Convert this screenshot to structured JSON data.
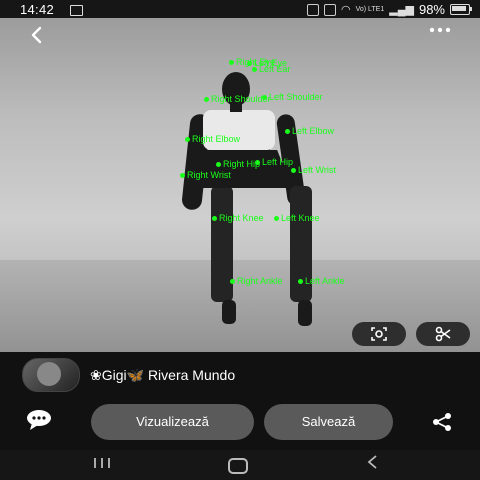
{
  "status": {
    "time": "14:42",
    "battery": "98%",
    "network_label": "Vo) LTE1"
  },
  "photo": {
    "keypoints": [
      {
        "label": "Right Eye"
      },
      {
        "label": "Left Eye"
      },
      {
        "label": "Left Ear"
      },
      {
        "label": "Right Shoulder"
      },
      {
        "label": "Left Shoulder"
      },
      {
        "label": "Right Elbow"
      },
      {
        "label": "Left Elbow"
      },
      {
        "label": "Right Hip"
      },
      {
        "label": "Left Hip"
      },
      {
        "label": "Right Wrist"
      },
      {
        "label": "Left Wrist"
      },
      {
        "label": "Right Knee"
      },
      {
        "label": "Left Knee"
      },
      {
        "label": "Right Ankle"
      },
      {
        "label": "Left Ankle"
      }
    ]
  },
  "profile": {
    "name": "❀Gigi🦋 Rivera Mundo"
  },
  "actions": {
    "view_label": "Vizualizează",
    "save_label": "Salvează"
  },
  "icons": {
    "back": "chevron-left-icon",
    "more": "more-horizontal-icon",
    "lens": "lens-icon",
    "scissors": "scissors-icon",
    "comment": "comment-icon",
    "share": "share-icon"
  },
  "colors": {
    "keypoint": "#1aff1a",
    "button_bg": "#5a5a5a",
    "background": "#111111"
  }
}
